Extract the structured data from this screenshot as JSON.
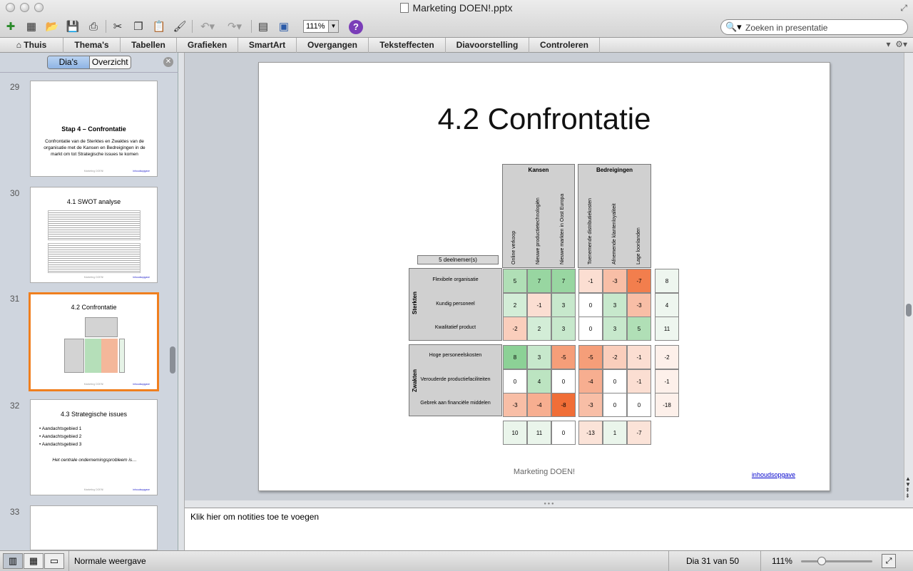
{
  "window": {
    "title": "Marketing DOEN!.pptx"
  },
  "toolbar": {
    "zoom": "111%",
    "help": "?",
    "search_placeholder": "Zoeken in presentatie"
  },
  "ribbon": {
    "tabs": [
      "Thuis",
      "Thema's",
      "Tabellen",
      "Grafieken",
      "SmartArt",
      "Overgangen",
      "Teksteffecten",
      "Diavoorstelling",
      "Controleren"
    ]
  },
  "left_panel": {
    "seg_slides": "Dia's",
    "seg_outline": "Overzicht",
    "slides": [
      {
        "num": "29",
        "title": "Stap 4 – Confrontatie",
        "body": "Confrontatie van de Sterktes en Zwaktes van de organisatie met de Kansen en Bedreigingen in de markt om tot Strategische issues te komen"
      },
      {
        "num": "30",
        "title": "4.1 SWOT analyse"
      },
      {
        "num": "31",
        "title": "4.2 Confrontatie"
      },
      {
        "num": "32",
        "title": "4.3 Strategische issues",
        "bullets": [
          "Aandachtsgebied 1",
          "Aandachtsgebied 2",
          "Aandachtsgebied 3"
        ],
        "note": "Het centrale ondernemingsprobleem is…"
      },
      {
        "num": "33"
      }
    ],
    "thumb_footer": "Marketing DOEN!",
    "thumb_link": "inhoudsopgave"
  },
  "slide": {
    "title": "4.2 Confrontatie",
    "participants": "5  deelnemer(s)",
    "kansen_label": "Kansen",
    "bedreigingen_label": "Bedreigingen",
    "kansen_cols": [
      "Online verkoop",
      "Nieuwe productietechnologiën",
      "Nieuwe markten in Oost Europa"
    ],
    "bedreigingen_cols": [
      "Toenemende distributiekosten",
      "Afnemende klantenloyaliteit",
      "Lage loonlanden"
    ],
    "sterkten_label": "Sterkten",
    "zwakten_label": "Zwakten",
    "sterkten_rows": [
      "Flexibele organisatie",
      "Kundig personeel",
      "Kwalitatief product"
    ],
    "zwakten_rows": [
      "Hoge personeelskosten",
      "Verouderde productiefaciliteiten",
      "Gebrek aan financiële middelen"
    ],
    "matrix": [
      [
        "5",
        "7",
        "7",
        "-1",
        "-3",
        "-7",
        "8"
      ],
      [
        "2",
        "-1",
        "3",
        "0",
        "3",
        "-3",
        "4"
      ],
      [
        "-2",
        "2",
        "3",
        "0",
        "3",
        "5",
        "11"
      ],
      [
        "8",
        "3",
        "-5",
        "-5",
        "-2",
        "-1",
        "-2"
      ],
      [
        "0",
        "4",
        "0",
        "-4",
        "0",
        "-1",
        "-1"
      ],
      [
        "-3",
        "-4",
        "-8",
        "-3",
        "0",
        "0",
        "-18"
      ]
    ],
    "col_totals": [
      "10",
      "11",
      "0",
      "-13",
      "1",
      "-7"
    ],
    "footer": "Marketing DOEN!",
    "link": "inhoudsopgave"
  },
  "notes": {
    "placeholder": "Klik hier om notities toe te voegen"
  },
  "status": {
    "view": "Normale weergave",
    "slide_pos": "Dia 31 van 50",
    "zoom": "111%"
  }
}
